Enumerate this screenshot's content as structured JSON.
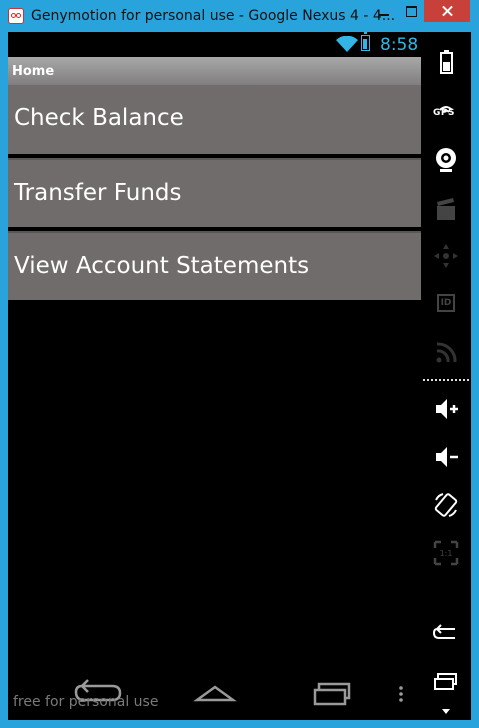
{
  "window": {
    "title": "Genymotion for personal use - Google Nexus 4 - 4..."
  },
  "status_bar": {
    "time": "8:58",
    "accent_color": "#33b5e5",
    "battery_level": 0.8
  },
  "action_bar": {
    "title": "Home"
  },
  "menu": {
    "items": [
      {
        "label": "Check Balance"
      },
      {
        "label": "Transfer Funds"
      },
      {
        "label": "View Account Statements"
      }
    ]
  },
  "watermark": "free for personal use",
  "sidebar": {
    "gps_label": "GPS",
    "id_label": "ID",
    "pixel_label": "1:1"
  },
  "colors": {
    "frame": "#29a3dc",
    "menu_item_bg": "#706c6b",
    "close_button": "#c7413a"
  }
}
